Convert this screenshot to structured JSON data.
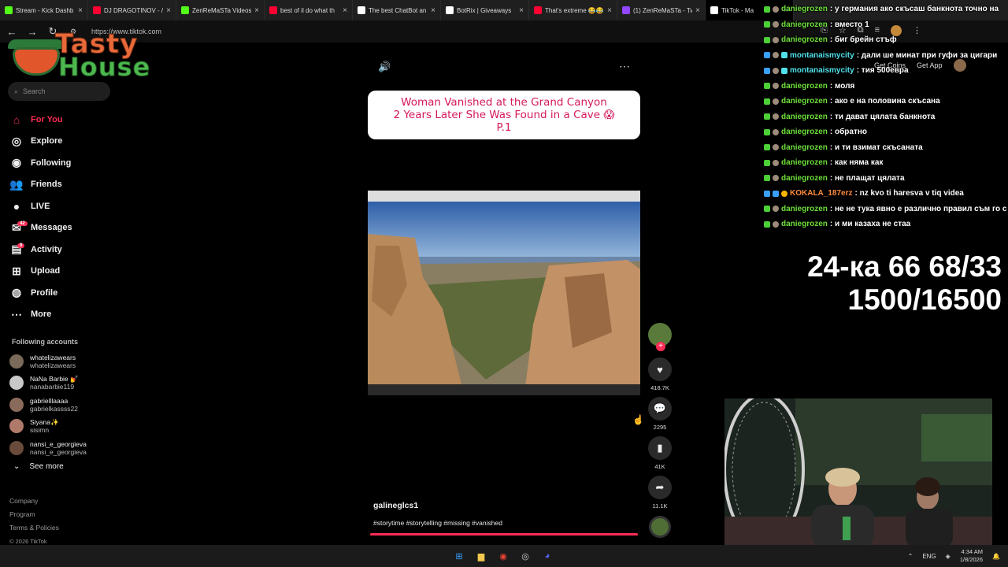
{
  "browser": {
    "tabs": [
      {
        "label": "Stream - Kick Dashb",
        "color": "#53fc18"
      },
      {
        "label": "DJ DRAGOTINOV - /",
        "color": "#ff0033"
      },
      {
        "label": "ZenReMaSTa Videos",
        "color": "#53fc18"
      },
      {
        "label": "best of il do what th",
        "color": "#ff0033"
      },
      {
        "label": "The best ChatBot an",
        "color": "#ffffff"
      },
      {
        "label": "BotRix | Giveaways",
        "color": "#ffffff"
      },
      {
        "label": "That's extreme 😂😂",
        "color": "#ff0033"
      },
      {
        "label": "(1) ZenReMaSTa - Tw",
        "color": "#9146ff"
      },
      {
        "label": "TikTok - Ma",
        "color": "#ffffff"
      }
    ],
    "url": "https://www.tiktok.com"
  },
  "logo": {
    "word1": "Tasty",
    "word2": "House"
  },
  "sidebar": {
    "search_placeholder": "Search",
    "nav": [
      {
        "label": "For You",
        "icon": "home-icon",
        "glyph": "⌂",
        "active": true
      },
      {
        "label": "Explore",
        "icon": "compass-icon",
        "glyph": "◎"
      },
      {
        "label": "Following",
        "icon": "following-icon",
        "glyph": "◉"
      },
      {
        "label": "Friends",
        "icon": "friends-icon",
        "glyph": "👥"
      },
      {
        "label": "LIVE",
        "icon": "live-icon",
        "glyph": "●"
      },
      {
        "label": "Messages",
        "icon": "messages-icon",
        "glyph": "✉",
        "badge": "42"
      },
      {
        "label": "Activity",
        "icon": "activity-icon",
        "glyph": "▤",
        "badge": "9"
      },
      {
        "label": "Upload",
        "icon": "upload-icon",
        "glyph": "⊞"
      },
      {
        "label": "Profile",
        "icon": "profile-icon",
        "glyph": "◍"
      },
      {
        "label": "More",
        "icon": "more-icon",
        "glyph": "⋯"
      }
    ],
    "following_title": "Following accounts",
    "accounts": [
      {
        "name": "whatelizawears",
        "handle": "whatelizawears"
      },
      {
        "name": "NaNa Barbie 💅",
        "handle": "nanabarbie119"
      },
      {
        "name": "gabrielllaaaa",
        "handle": "gabrielkassss22"
      },
      {
        "name": "Siyana✨",
        "handle": "sisimn"
      },
      {
        "name": "nansi_e_georgieva",
        "handle": "nansi_e_georgieva"
      }
    ],
    "see_more": "See more",
    "footer": [
      "Company",
      "Program",
      "Terms & Policies"
    ],
    "copyright": "© 2026 TikTok"
  },
  "video": {
    "title_lines": [
      "Woman Vanished at the Grand Canyon",
      "2 Years Later She Was Found in a Cave 😱",
      "P.1"
    ],
    "author": "galineglcs1",
    "hashtags": "#storytime #storytelling #missing #vanished",
    "likes": "418.7K",
    "comments": "2295",
    "saves": "41K",
    "shares": "11.1K"
  },
  "chat": {
    "messages": [
      {
        "user": "daniegrozen",
        "text": ": у германия ако скъсаш банкнота точно на",
        "style": "green"
      },
      {
        "user": "daniegrozen",
        "text": ": вместо 1",
        "style": "green"
      },
      {
        "user": "daniegrozen",
        "text": ": биг брейн стъф",
        "style": "green"
      },
      {
        "user": "montanaismycity",
        "text": ": дали ше минат при гуфи за цигари",
        "style": "cyan"
      },
      {
        "user": "montanaismycity",
        "text": ": тия 500евра",
        "style": "cyan"
      },
      {
        "user": "daniegrozen",
        "text": ": моля",
        "style": "green"
      },
      {
        "user": "daniegrozen",
        "text": ": ако е на половина скъсана",
        "style": "green"
      },
      {
        "user": "daniegrozen",
        "text": ": ти дават цялата банкнота",
        "style": "green"
      },
      {
        "user": "daniegrozen",
        "text": ": обратно",
        "style": "green"
      },
      {
        "user": "daniegrozen",
        "text": ": и ти взимат скъсаната",
        "style": "green"
      },
      {
        "user": "daniegrozen",
        "text": ": как няма как",
        "style": "green"
      },
      {
        "user": "daniegrozen",
        "text": ": не плащат цялата",
        "style": "green"
      },
      {
        "user": "KOKALA_187erz",
        "text": ": nz kvo ti haresva v tiq videa",
        "style": "orange"
      },
      {
        "user": "daniegrozen",
        "text": ": не не тука явно е различно правил съм го с",
        "style": "green"
      },
      {
        "user": "daniegrozen",
        "text": ": и ми казаха не стаа",
        "style": "green"
      }
    ]
  },
  "topbar": {
    "get_coins": "Get Coins",
    "get_app": "Get App"
  },
  "overlay_stats": {
    "line1": "24-ка 66 68/33",
    "line2": "1500/16500"
  },
  "taskbar": {
    "lang": "ENG",
    "time": "4:34 AM",
    "date": "1/8/2026"
  }
}
